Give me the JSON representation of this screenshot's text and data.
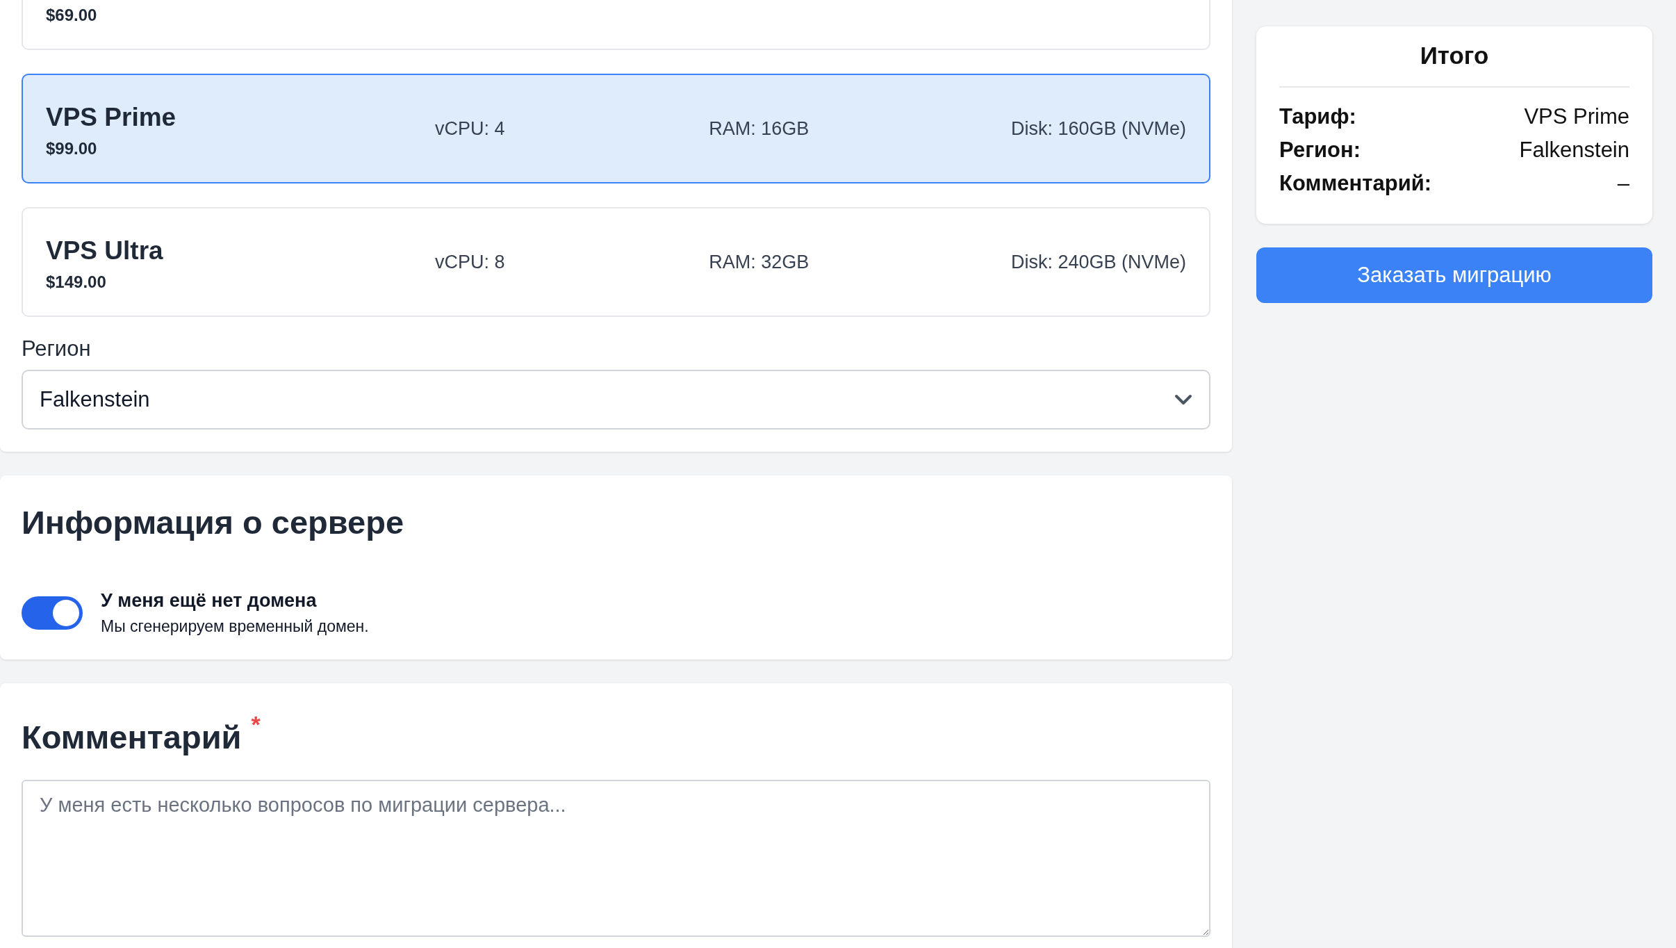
{
  "plans": [
    {
      "price": "$69.00",
      "selected": false
    },
    {
      "name": "VPS Prime",
      "price": "$99.00",
      "vcpu": "vCPU: 4",
      "ram": "RAM: 16GB",
      "disk": "Disk: 160GB (NVMe)",
      "selected": true
    },
    {
      "name": "VPS Ultra",
      "price": "$149.00",
      "vcpu": "vCPU: 8",
      "ram": "RAM: 32GB",
      "disk": "Disk: 240GB (NVMe)",
      "selected": false
    }
  ],
  "region": {
    "label": "Регион",
    "value": "Falkenstein"
  },
  "server_info": {
    "title": "Информация о сервере",
    "toggle": {
      "on": true,
      "label": "У меня ещё нет домена",
      "description": "Мы сгенерируем временный домен."
    }
  },
  "comment": {
    "title": "Комментарий",
    "required_mark": "*",
    "placeholder": "У меня есть несколько вопросов по миграции сервера..."
  },
  "summary": {
    "title": "Итого",
    "rows": [
      {
        "label": "Тариф:",
        "value": "VPS Prime"
      },
      {
        "label": "Регион:",
        "value": "Falkenstein"
      },
      {
        "label": "Комментарий:",
        "value": "–"
      }
    ]
  },
  "order_button": "Заказать миграцию"
}
